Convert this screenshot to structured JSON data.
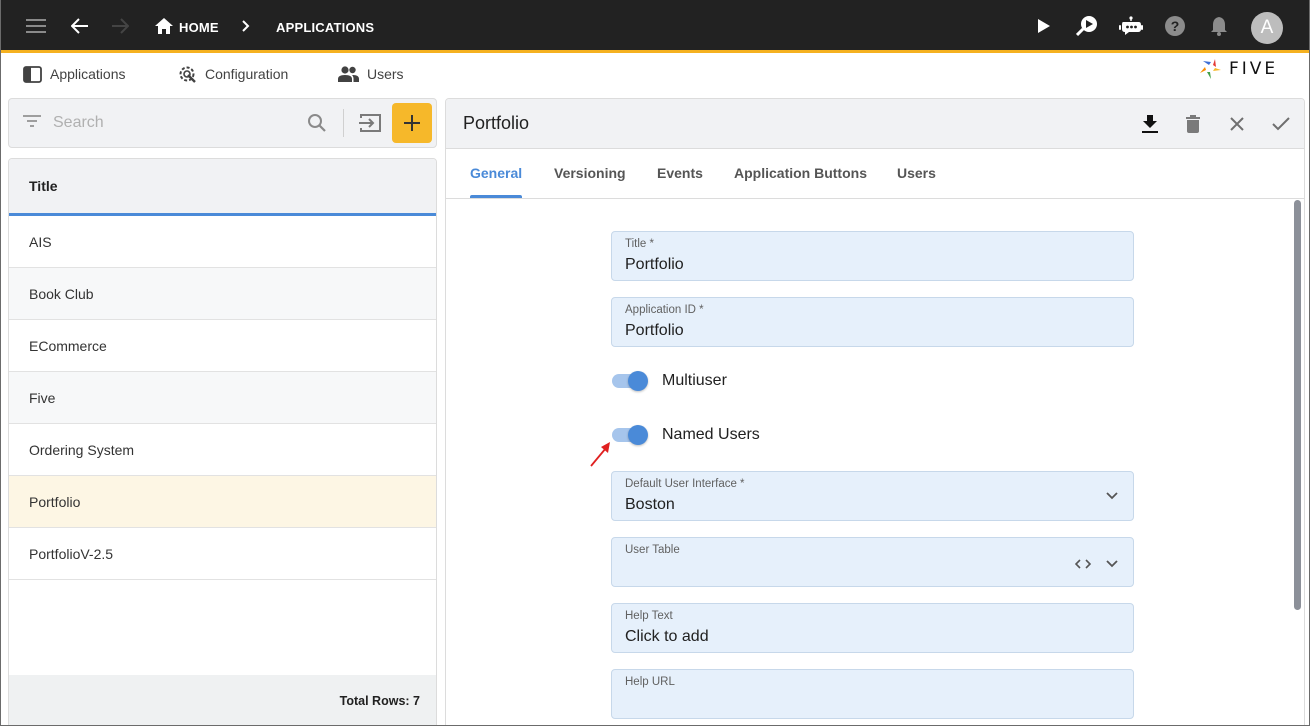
{
  "topbar": {
    "menu_icon": "hamburger-menu-icon",
    "back_icon": "arrow-left-icon",
    "forward_icon": "arrow-right-icon",
    "breadcrumb": [
      {
        "label": "HOME",
        "icon": "home-icon"
      },
      {
        "label": "APPLICATIONS"
      }
    ],
    "actions": [
      {
        "name": "run",
        "icon": "play-icon"
      },
      {
        "name": "inspect",
        "icon": "search-play-icon"
      },
      {
        "name": "chat",
        "icon": "robot-chat-icon"
      },
      {
        "name": "help",
        "icon": "help-circle-icon"
      },
      {
        "name": "notifications",
        "icon": "bell-icon"
      }
    ],
    "avatar_letter": "A",
    "accent_color": "#f5b120"
  },
  "subnav": {
    "items": [
      {
        "label": "Applications",
        "icon": "panel-icon"
      },
      {
        "label": "Configuration",
        "icon": "gear-wrench-icon"
      },
      {
        "label": "Users",
        "icon": "users-icon"
      }
    ],
    "logo_text": "FIVE"
  },
  "list": {
    "search_placeholder": "Search",
    "header": "Title",
    "rows": [
      "AIS",
      "Book Club",
      "ECommerce",
      "Five",
      "Ordering System",
      "Portfolio",
      "PortfolioV-2.5"
    ],
    "selected": "Portfolio",
    "footer": "Total Rows: 7"
  },
  "form": {
    "title": "Portfolio",
    "tabs": [
      "General",
      "Versioning",
      "Events",
      "Application Buttons",
      "Users"
    ],
    "active_tab": "General",
    "fields": {
      "title": {
        "label": "Title *",
        "value": "Portfolio"
      },
      "app_id": {
        "label": "Application ID *",
        "value": "Portfolio"
      },
      "multiuser": {
        "label": "Multiuser",
        "on": true
      },
      "named_users": {
        "label": "Named Users",
        "on": true
      },
      "default_ui": {
        "label": "Default User Interface *",
        "value": "Boston"
      },
      "user_table": {
        "label": "User Table",
        "value": ""
      },
      "help_text": {
        "label": "Help Text",
        "value": "Click to add"
      },
      "help_url": {
        "label": "Help URL",
        "value": ""
      }
    }
  }
}
